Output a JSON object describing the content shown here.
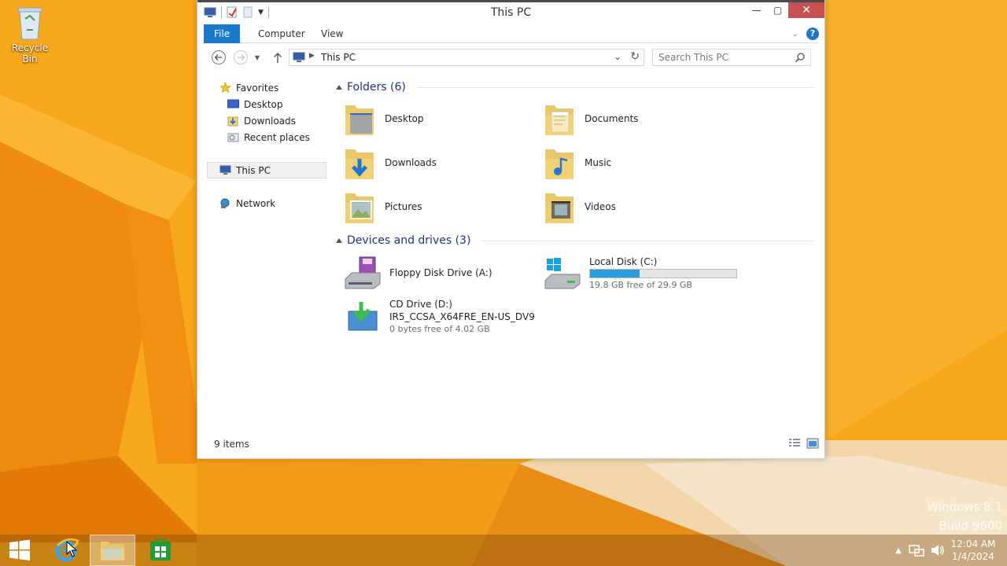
{
  "desktop": {
    "recycle_bin_label": "Recycle Bin",
    "watermark_line1": "Windows 8.1",
    "watermark_line2": "Build 9600"
  },
  "window": {
    "title": "This PC",
    "ribbon_tabs": [
      "File",
      "Computer",
      "View"
    ],
    "address": "This PC",
    "search_placeholder": "Search This PC"
  },
  "nav_pane": {
    "favorites": "Favorites",
    "favorites_items": [
      "Desktop",
      "Downloads",
      "Recent places"
    ],
    "this_pc": "This PC",
    "network": "Network"
  },
  "content": {
    "folders_header": "Folders (6)",
    "folders": [
      {
        "name": "Desktop",
        "icon": "desktop-folder-icon"
      },
      {
        "name": "Documents",
        "icon": "documents-folder-icon"
      },
      {
        "name": "Downloads",
        "icon": "downloads-folder-icon"
      },
      {
        "name": "Music",
        "icon": "music-folder-icon"
      },
      {
        "name": "Pictures",
        "icon": "pictures-folder-icon"
      },
      {
        "name": "Videos",
        "icon": "videos-folder-icon"
      }
    ],
    "devices_header": "Devices and drives (3)",
    "drives": [
      {
        "name": "Floppy Disk Drive (A:)",
        "icon": "floppy-drive-icon"
      },
      {
        "name": "Local Disk (C:)",
        "icon": "local-disk-icon",
        "free_text": "19.8 GB free of 29.9 GB",
        "used_fraction": 0.338
      },
      {
        "name": "CD Drive (D:)",
        "label": "IR5_CCSA_X64FRE_EN-US_DV9",
        "icon": "cd-drive-icon",
        "free_text": "0 bytes free of 4.02 GB"
      }
    ]
  },
  "status": {
    "items_count": "9 items"
  },
  "taskbar": {
    "time": "12:04 AM",
    "date": "1/4/2024"
  },
  "colors": {
    "accent": "#1979ca",
    "group_header": "#1e3287",
    "capacity_fill": "#26a0da",
    "wallpaper": "#f6a618"
  }
}
